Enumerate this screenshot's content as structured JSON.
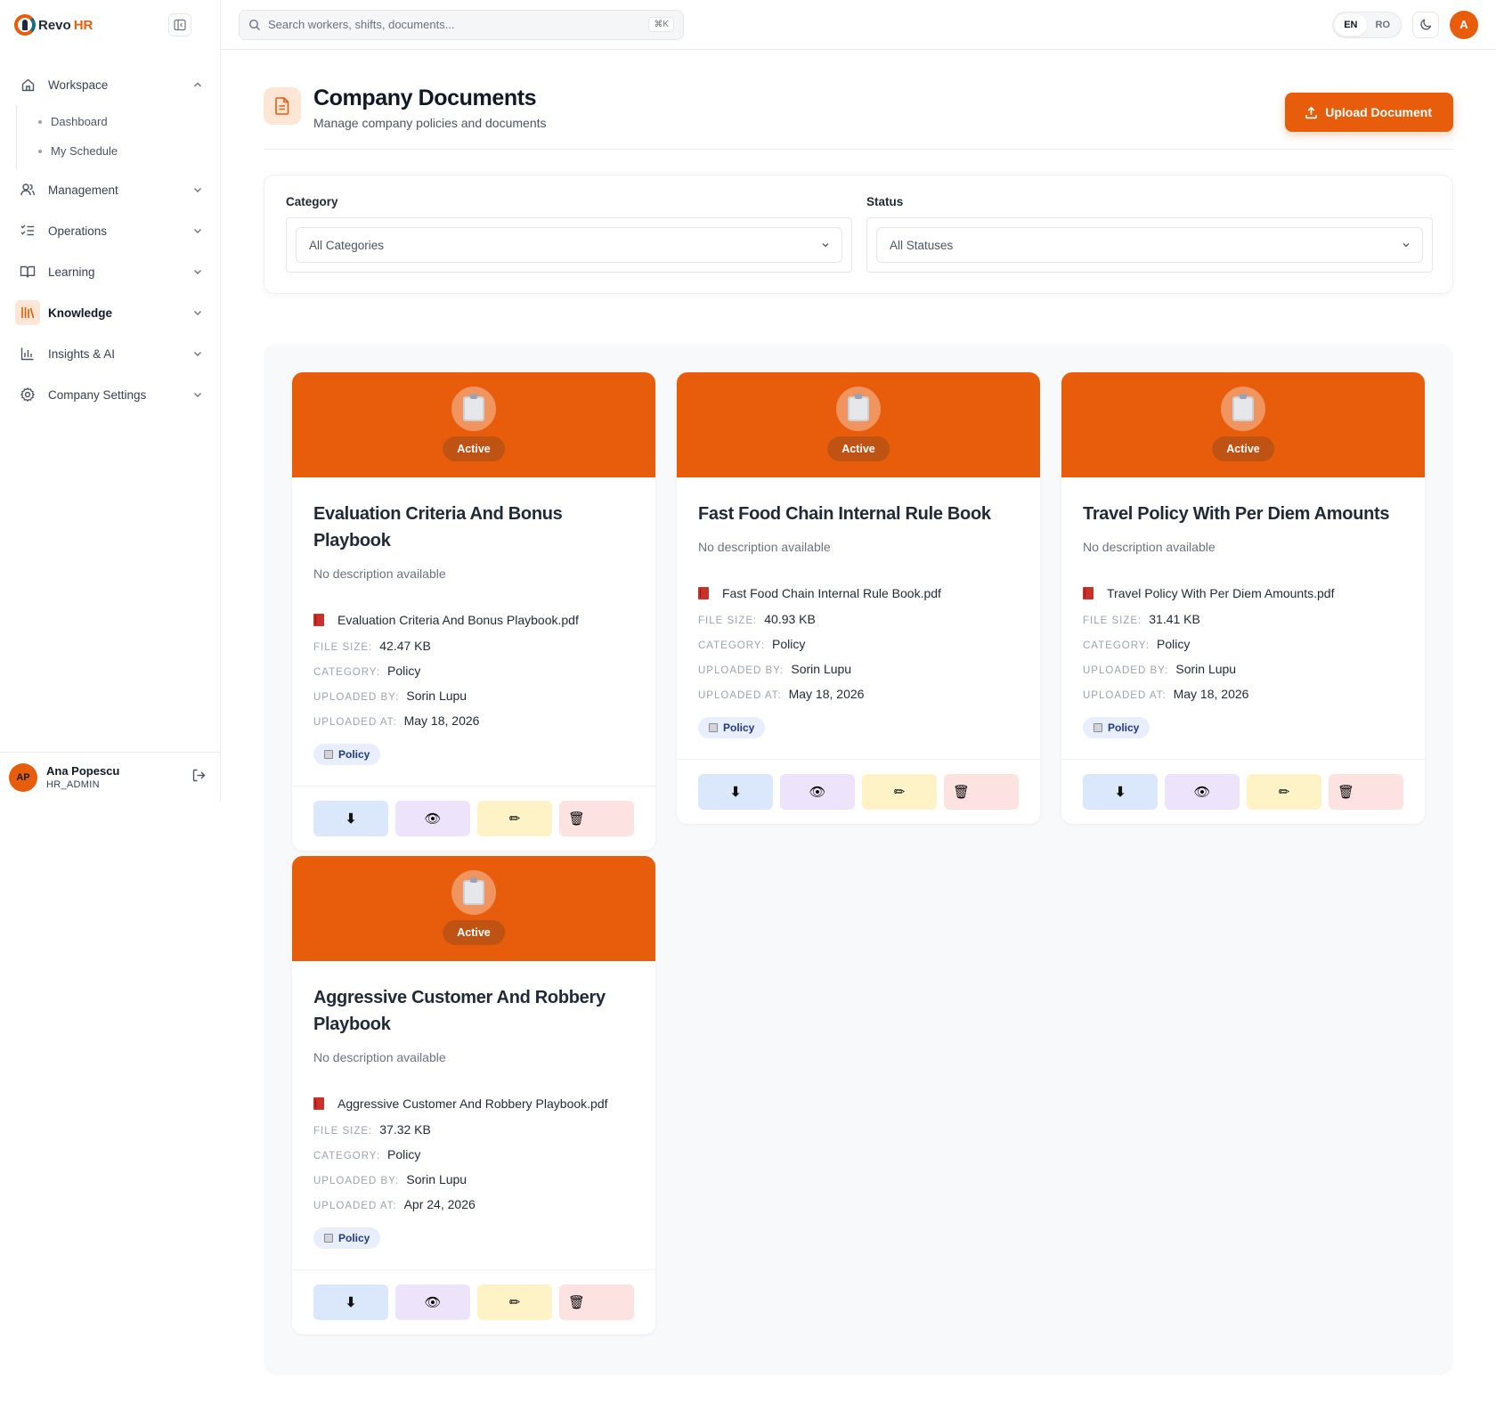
{
  "brand": {
    "name_part1": "Revo",
    "name_part2": "HR"
  },
  "search": {
    "placeholder": "Search workers, shifts, documents...",
    "shortcut": "⌘K"
  },
  "language": {
    "options": [
      "EN",
      "RO"
    ],
    "active": "EN"
  },
  "top_avatar_initial": "A",
  "sidebar": {
    "workspace": {
      "label": "Workspace",
      "children": [
        "Dashboard",
        "My Schedule"
      ]
    },
    "items": [
      {
        "label": "Management",
        "icon": "users-icon"
      },
      {
        "label": "Operations",
        "icon": "checklist-icon"
      },
      {
        "label": "Learning",
        "icon": "book-open-icon"
      },
      {
        "label": "Knowledge",
        "icon": "library-icon",
        "active": true
      },
      {
        "label": "Insights & AI",
        "icon": "bar-chart-icon"
      },
      {
        "label": "Company Settings",
        "icon": "gear-icon"
      }
    ],
    "user": {
      "initials": "AP",
      "name": "Ana Popescu",
      "role": "HR_ADMIN"
    }
  },
  "page": {
    "title": "Company Documents",
    "subtitle": "Manage company policies and documents",
    "upload_label": "Upload Document"
  },
  "filters": {
    "category": {
      "label": "Category",
      "value": "All Categories"
    },
    "status": {
      "label": "Status",
      "value": "All Statuses"
    }
  },
  "labels": {
    "file_size": "FILE SIZE:",
    "category": "CATEGORY:",
    "uploaded_by": "UPLOADED BY:",
    "uploaded_at": "UPLOADED AT:"
  },
  "documents": [
    {
      "status": "Active",
      "title": "Evaluation Criteria And Bonus Playbook",
      "description": "No description available",
      "file_name": "Evaluation Criteria And Bonus Playbook.pdf",
      "file_size": "42.47 KB",
      "category": "Policy",
      "uploaded_by": "Sorin Lupu",
      "uploaded_at": "May 18, 2026",
      "tag": "Policy"
    },
    {
      "status": "Active",
      "title": "Fast Food Chain Internal Rule Book",
      "description": "No description available",
      "file_name": "Fast Food Chain Internal Rule Book.pdf",
      "file_size": "40.93 KB",
      "category": "Policy",
      "uploaded_by": "Sorin Lupu",
      "uploaded_at": "May 18, 2026",
      "tag": "Policy"
    },
    {
      "status": "Active",
      "title": "Travel Policy With Per Diem Amounts",
      "description": "No description available",
      "file_name": "Travel Policy With Per Diem Amounts.pdf",
      "file_size": "31.41 KB",
      "category": "Policy",
      "uploaded_by": "Sorin Lupu",
      "uploaded_at": "May 18, 2026",
      "tag": "Policy"
    },
    {
      "status": "Active",
      "title": "Aggressive Customer And Robbery Playbook",
      "description": "No description available",
      "file_name": "Aggressive Customer And Robbery Playbook.pdf",
      "file_size": "37.32 KB",
      "category": "Policy",
      "uploaded_by": "Sorin Lupu",
      "uploaded_at": "Apr 24, 2026",
      "tag": "Policy"
    }
  ],
  "actions": {
    "download": "⬇",
    "view": "👁",
    "edit": "✏",
    "delete": "🗑"
  },
  "colors": {
    "accent": "#e85d0c",
    "accent_soft": "#fde6d6"
  }
}
